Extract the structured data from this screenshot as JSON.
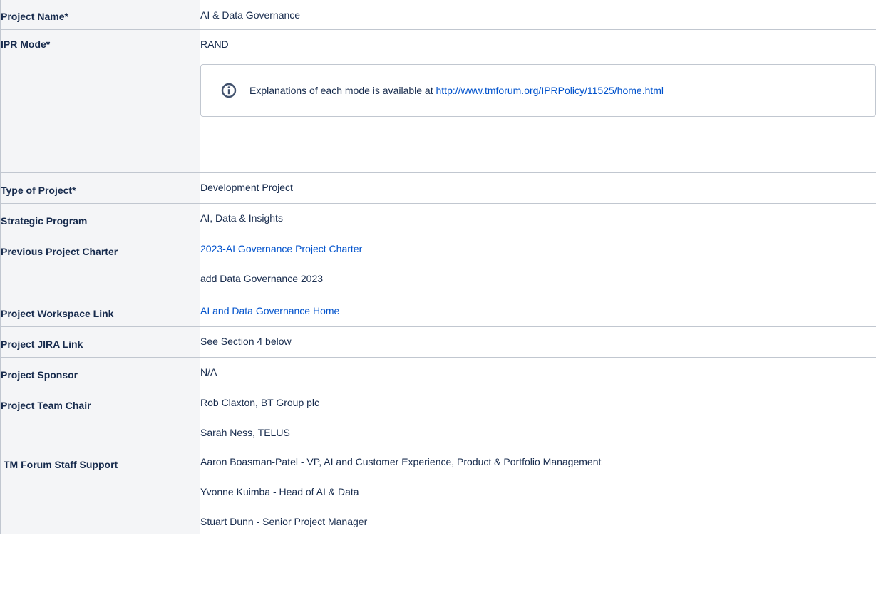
{
  "rows": {
    "project_name": {
      "label": "Project Name*",
      "value": "AI & Data Governance"
    },
    "ipr_mode": {
      "label": "IPR Mode*",
      "value": "RAND",
      "info": {
        "icon": "info-icon",
        "text": "Explanations of each mode is available at ",
        "link": "http://www.tmforum.org/IPRPolicy/11525/home.html"
      }
    },
    "type_of_project": {
      "label": "Type of Project*",
      "value": "Development Project"
    },
    "strategic_program": {
      "label": "Strategic Program",
      "value": "AI, Data & Insights"
    },
    "previous_charter": {
      "label": "Previous Project Charter",
      "link": "2023-AI Governance Project Charter",
      "value": "add Data Governance 2023"
    },
    "workspace_link": {
      "label": "Project Workspace Link",
      "link": "AI and Data Governance Home"
    },
    "jira_link": {
      "label": "Project JIRA Link",
      "value": "See Section 4 below"
    },
    "sponsor": {
      "label": "Project Sponsor",
      "value": "N/A"
    },
    "team_chair": {
      "label": "Project Team Chair",
      "values": [
        "Rob Claxton, BT Group plc",
        "Sarah Ness, TELUS"
      ]
    },
    "staff_support": {
      "label": "TM Forum Staff Support",
      "values": [
        "Aaron Boasman-Patel - VP, AI and Customer Experience, Product & Portfolio Management",
        "Yvonne Kuimba - Head of AI & Data",
        "Stuart Dunn - Senior Project Manager"
      ]
    }
  },
  "colors": {
    "link": "#0052cc",
    "label_bg": "#f4f5f7",
    "border": "#c1c7d0",
    "text": "#172b4d"
  }
}
